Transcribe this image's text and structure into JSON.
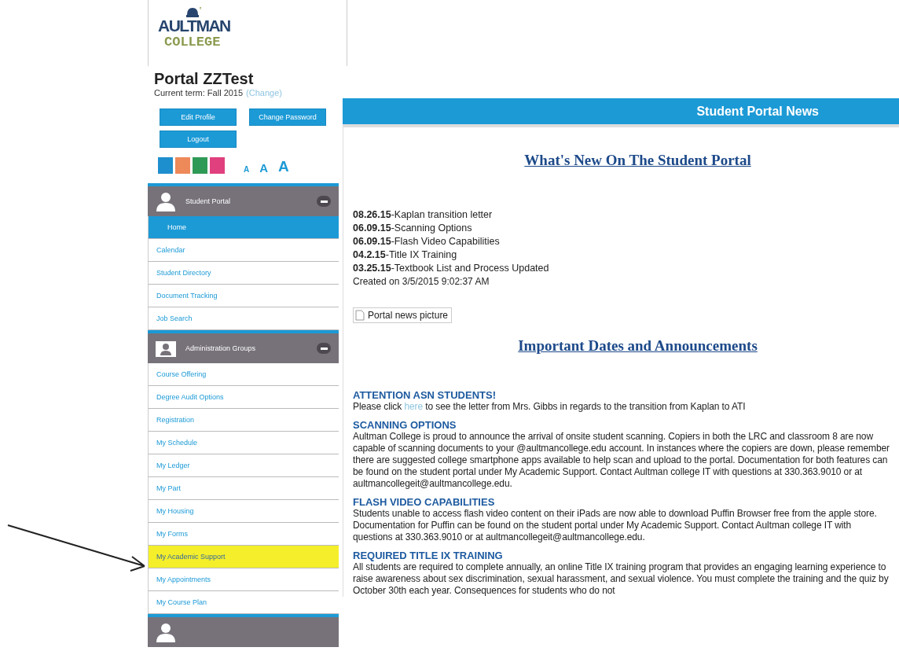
{
  "logo": {
    "line1": "AULTMAN",
    "line2": "COLLEGE"
  },
  "portal": {
    "title": "Portal ZZTest",
    "term": "Current term: Fall 2015",
    "change_link": "(Change)"
  },
  "buttons": [
    "Edit Profile",
    "Change Password",
    "Logout"
  ],
  "themes": [
    {
      "color": "#1e8fce"
    },
    {
      "color": "#ee8a5a"
    },
    {
      "color": "#2f9a55"
    },
    {
      "color": "#e0407e"
    }
  ],
  "font_sizes": [
    "A",
    "A",
    "A"
  ],
  "sidebar": {
    "groups": [
      {
        "title": "Student Portal",
        "kind": "person",
        "expanded": true,
        "items": [
          {
            "label": "Home",
            "selected": true,
            "highlighted": false
          },
          {
            "label": "Calendar",
            "selected": false,
            "highlighted": false
          },
          {
            "label": "Student Directory",
            "selected": false,
            "highlighted": false
          },
          {
            "label": "Document Tracking",
            "selected": false,
            "highlighted": false
          },
          {
            "label": "Job Search",
            "selected": false,
            "highlighted": false
          }
        ]
      },
      {
        "title": "Administration Groups",
        "kind": "folder",
        "expanded": true,
        "items": [
          {
            "label": "Course Offering",
            "selected": false,
            "highlighted": false
          },
          {
            "label": "Degree Audit Options",
            "selected": false,
            "highlighted": false
          },
          {
            "label": "Registration",
            "selected": false,
            "highlighted": false
          },
          {
            "label": "My Schedule",
            "selected": false,
            "highlighted": false
          },
          {
            "label": "My Ledger",
            "selected": false,
            "highlighted": false
          },
          {
            "label": "My Part",
            "selected": false,
            "highlighted": false
          },
          {
            "label": "My Housing",
            "selected": false,
            "highlighted": false
          },
          {
            "label": "My Forms",
            "selected": false,
            "highlighted": false
          },
          {
            "label": "My Academic Support",
            "selected": false,
            "highlighted": true
          },
          {
            "label": "My Appointments",
            "selected": false,
            "highlighted": false
          },
          {
            "label": "My Course Plan",
            "selected": false,
            "highlighted": false
          }
        ]
      },
      {
        "kind": "person"
      }
    ]
  },
  "news": {
    "header": "Student Portal News",
    "heading": "What's New On The Student Portal",
    "items": [
      {
        "date": "08.26.15",
        "title": "-Kaplan transition letter"
      },
      {
        "date": "06.09.15",
        "title": "-Scanning Options"
      },
      {
        "date": "06.09.15",
        "title": "-Flash Video Capabilities"
      },
      {
        "date": "04.2.15",
        "title": "-Title IX Training"
      },
      {
        "date": "03.25.15",
        "title": "-Textbook List and Process Updated"
      }
    ],
    "created": "Created on 3/5/2015 9:02:37 AM",
    "picture_alt": "Portal news picture",
    "heading2": "Important Dates and Announcements",
    "announcements": [
      {
        "title": "ATTENTION ASN STUDENTS!",
        "before": "Please click ",
        "link": "here",
        "after": " to see the letter from Mrs. Gibbs in regards to the transition from Kaplan to ATI"
      },
      {
        "title": "SCANNING OPTIONS",
        "before": "Aultman College is proud to announce the arrival of onsite student scanning. Copiers in both the LRC and classroom 8 are now capable of scanning documents to your @aultmancollege.edu account. In instances where the copiers are down, please remember there are suggested college smartphone apps available to help scan and upload to the portal. Documentation for both features can be found on the student portal under My Academic Support. Contact Aultman college IT with questions at 330.363.9010 or at aultmancollegeit@aultmancollege.edu."
      },
      {
        "title": "FLASH VIDEO CAPABILITIES",
        "before": "Students unable to access flash video content on their iPads are now able to download Puffin Browser free from the apple store. Documentation for Puffin can be found on the student portal under My Academic Support. Contact Aultman college IT with questions at 330.363.9010 or at aultmancollegeit@aultmancollege.edu."
      },
      {
        "title": "REQUIRED TITLE IX TRAINING",
        "before": "All students are required to complete annually, an online Title IX training program that provides an engaging learning experience to raise awareness about sex discrimination, sexual harassment, and sexual violence. You must complete the training and the quiz by October 30th each year. Consequences for students who do not"
      }
    ]
  },
  "annotation": {
    "arrow": true
  }
}
